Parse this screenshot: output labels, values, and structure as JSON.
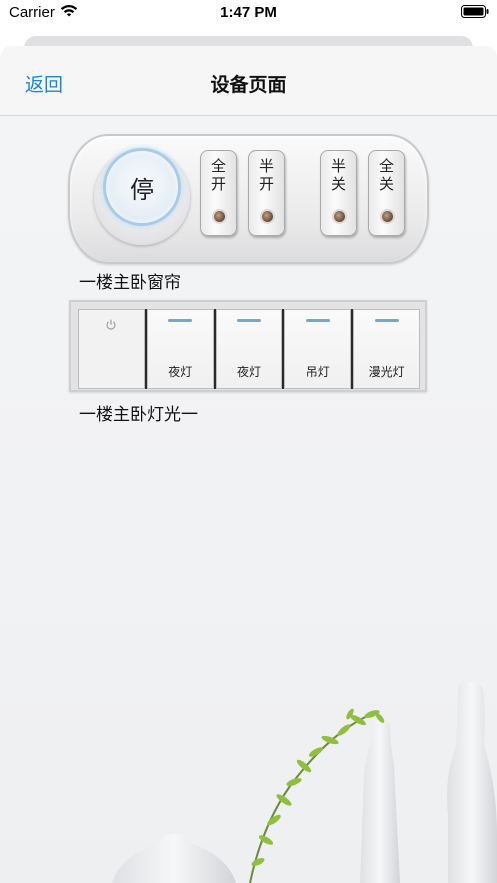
{
  "status_bar": {
    "carrier": "Carrier",
    "time": "1:47 PM"
  },
  "nav": {
    "back_label": "返回",
    "title": "设备页面"
  },
  "curtain": {
    "stop_label": "停",
    "buttons": [
      {
        "label": "全\n开"
      },
      {
        "label": "半\n开"
      },
      {
        "label": "半\n关"
      },
      {
        "label": "全\n关"
      }
    ],
    "device_name": "一楼主卧窗帘"
  },
  "lights": {
    "keys": [
      {
        "label": "夜灯"
      },
      {
        "label": "夜灯"
      },
      {
        "label": "吊灯"
      },
      {
        "label": "漫光灯"
      }
    ],
    "device_name": "一楼主卧灯光一"
  },
  "icons": {
    "wifi": "wifi-icon",
    "battery": "battery-icon",
    "power": "power-icon"
  },
  "colors": {
    "accent": "#1a86d8",
    "indicator": "#7ea4c2",
    "stop_ring": "#a7cce8"
  }
}
